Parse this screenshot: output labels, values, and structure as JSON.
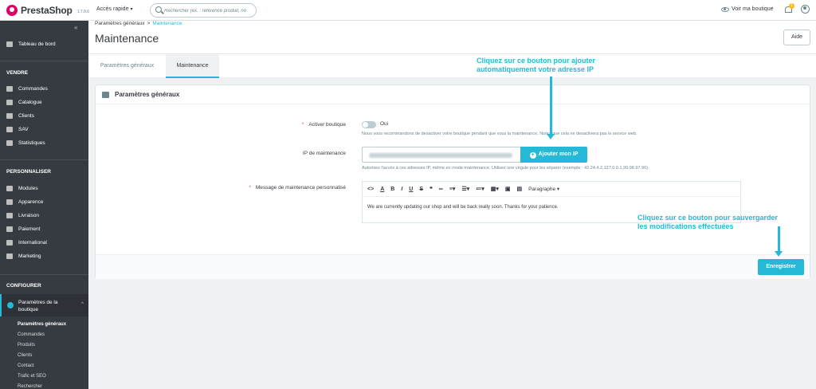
{
  "topbar": {
    "logo": "PrestaShop",
    "version": "1.7.8.6",
    "quick_access": "Accès rapide",
    "search_placeholder": "Rechercher (ex. : référence produit, no",
    "view_shop": "Voir ma boutique",
    "notifications_count": "1"
  },
  "sidebar": {
    "dashboard": "Tableau de bord",
    "sections": [
      {
        "title": "VENDRE",
        "items": [
          "Commandes",
          "Catalogue",
          "Clients",
          "SAV",
          "Statistiques"
        ]
      },
      {
        "title": "PERSONNALISER",
        "items": [
          "Modules",
          "Apparence",
          "Livraison",
          "Paiement",
          "International",
          "Marketing"
        ]
      },
      {
        "title": "CONFIGURER"
      }
    ],
    "active": "Paramètres de la boutique",
    "subitems": [
      "Paramètres généraux",
      "Commandes",
      "Produits",
      "Clients",
      "Contact",
      "Trafic et SEO",
      "Rechercher"
    ]
  },
  "header": {
    "breadcrumb_parent": "Paramètres généraux",
    "breadcrumb_sep": ">",
    "breadcrumb_current": "Maintenance",
    "title": "Maintenance",
    "help": "Aide",
    "tabs": [
      "Paramètres généraux",
      "Maintenance"
    ]
  },
  "form": {
    "panel_title": "Paramètres généraux",
    "enable_label": "Activer boutique",
    "enable_value": "Oui",
    "enable_hint": "Nous vous recommandons de desactiver votre boutique pendant que vous la maintenance. Notez que cela ne desactivera pas le service web.",
    "ip_label": "IP de maintenance",
    "ip_button": "Ajouter mon IP",
    "ip_hint": "Autorisez l'accès à ces adresses IP, même en mode maintenance. Utilisez une virgule pour les séparer (exemple : 42.24.4.2,127.0.0.1,99.98.97.96).",
    "message_label": "Message de maintenance personnalisé",
    "format_label": "Paragraphe",
    "message_text": "We are currently updating our shop and will be back really soon. Thanks for your patience.",
    "save": "Enregistrer"
  },
  "annotations": {
    "ip_callout": [
      "Cliquez sur ce bouton pour ajouter",
      "automatiquement votre adresse IP"
    ],
    "save_callout": [
      "Cliquez sur ce bouton pour sauvergarder",
      "les modifications effectuées"
    ]
  },
  "colors": {
    "accent": "#25b9d7",
    "sidebar": "#363a41",
    "brand": "#df0067"
  }
}
